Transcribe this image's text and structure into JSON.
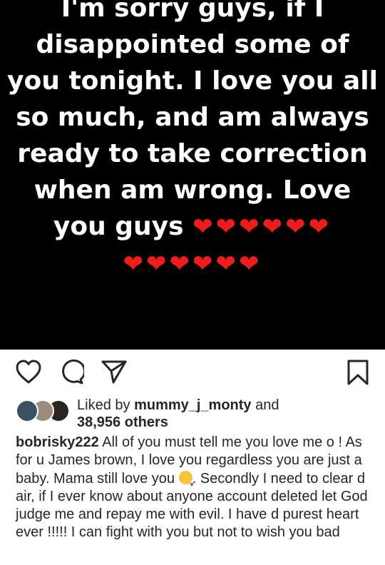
{
  "story": {
    "lines": [
      "I'm sorry guys, if I",
      "disappointed some of",
      "you tonight. I love you all",
      "so much, and am always",
      "ready to take correction",
      "when am wrong.  Love",
      "you guys"
    ],
    "hearts_row1": "❤❤❤❤❤❤",
    "hearts_row2": "❤❤❤❤❤❤",
    "heart_color": "#ef1c1c"
  },
  "actions": {
    "like_icon": "heart-outline-icon",
    "comment_icon": "comment-icon",
    "share_icon": "send-icon",
    "save_icon": "bookmark-icon"
  },
  "likes": {
    "prefix": "Liked by ",
    "user": "mummy_j_monty",
    "joiner": " and",
    "others": "38,956 others"
  },
  "caption": {
    "username": "bobrisky222",
    "text_part1": " All of you must tell me you love me o ! As for u James brown, I love you regardless you are just a baby. Mama still love you ",
    "emoji": "smiling-face-with-hearts-emoji",
    "text_part2": ". Secondly I need to clear d air, if I ever know about anyone account deleted let God judge me and repay me with evil. I have d purest heart ever !!!!! I can fight with you but not to wish you bad"
  }
}
